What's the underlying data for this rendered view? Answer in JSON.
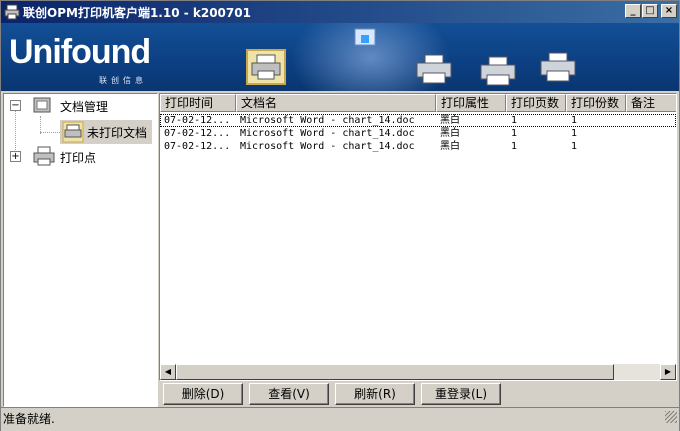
{
  "window": {
    "title": "联创OPM打印机客户端1.10 - k200701",
    "minimize_glyph": "_",
    "maximize_glyph": "□",
    "close_glyph": "×"
  },
  "banner": {
    "logo_text": "Unifound",
    "logo_subtitle": "联创信息"
  },
  "tree": {
    "root_doc": "文档管理",
    "child_unprinted": "未打印文档",
    "root_printer": "打印点",
    "expanded_glyph": "−",
    "collapsed_glyph": "+"
  },
  "list": {
    "columns": [
      "打印时间",
      "文档名",
      "打印属性",
      "打印页数",
      "打印份数",
      "备注"
    ],
    "rows": [
      {
        "time": "07-02-12...",
        "name": "Microsoft Word - chart_14.doc",
        "attr": "黑白",
        "pages": "1",
        "copies": "1",
        "note": ""
      },
      {
        "time": "07-02-12...",
        "name": "Microsoft Word - chart_14.doc",
        "attr": "黑白",
        "pages": "1",
        "copies": "1",
        "note": ""
      },
      {
        "time": "07-02-12...",
        "name": "Microsoft Word - chart_14.doc",
        "attr": "黑白",
        "pages": "1",
        "copies": "1",
        "note": ""
      }
    ]
  },
  "buttons": {
    "delete": "删除(D)",
    "view": "查看(V)",
    "refresh": "刷新(R)",
    "relogin": "重登录(L)"
  },
  "status": {
    "text": "准备就绪."
  }
}
